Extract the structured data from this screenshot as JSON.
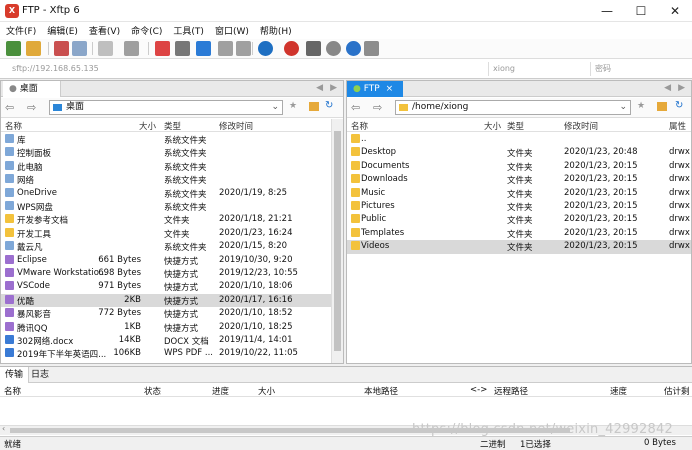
{
  "window": {
    "title": "FTP - Xftp 6",
    "minimize": "—",
    "maximize": "☐",
    "close": "✕"
  },
  "menu": [
    "文件(F)",
    "编辑(E)",
    "查看(V)",
    "命令(C)",
    "工具(T)",
    "窗口(W)",
    "帮助(H)"
  ],
  "address": {
    "host": "sftp://192.168.65.135",
    "user": "xiong",
    "password": "密码"
  },
  "left_panel": {
    "tab": "桌面",
    "path": "桌面",
    "columns": [
      "名称",
      "大小",
      "类型",
      "修改时间"
    ],
    "rows": [
      {
        "name": "库",
        "size": "",
        "type": "系统文件夹",
        "time": ""
      },
      {
        "name": "控制面板",
        "size": "",
        "type": "系统文件夹",
        "time": ""
      },
      {
        "name": "此电脑",
        "size": "",
        "type": "系统文件夹",
        "time": ""
      },
      {
        "name": "网络",
        "size": "",
        "type": "系统文件夹",
        "time": ""
      },
      {
        "name": "OneDrive",
        "size": "",
        "type": "系统文件夹",
        "time": "2020/1/19, 8:25"
      },
      {
        "name": "WPS网盘",
        "size": "",
        "type": "系统文件夹",
        "time": ""
      },
      {
        "name": "开发参考文档",
        "size": "",
        "type": "文件夹",
        "time": "2020/1/18, 21:21"
      },
      {
        "name": "开发工具",
        "size": "",
        "type": "文件夹",
        "time": "2020/1/23, 16:24"
      },
      {
        "name": "戴云凡",
        "size": "",
        "type": "系统文件夹",
        "time": "2020/1/15, 8:20"
      },
      {
        "name": "Eclipse",
        "size": "661 Bytes",
        "type": "快捷方式",
        "time": "2019/10/30, 9:20"
      },
      {
        "name": "VMware Workstatio...",
        "size": "698 Bytes",
        "type": "快捷方式",
        "time": "2019/12/23, 10:55"
      },
      {
        "name": "VSCode",
        "size": "971 Bytes",
        "type": "快捷方式",
        "time": "2020/1/10, 18:06"
      },
      {
        "name": "优酷",
        "size": "2KB",
        "type": "快捷方式",
        "time": "2020/1/17, 16:16"
      },
      {
        "name": "暴风影音",
        "size": "772 Bytes",
        "type": "快捷方式",
        "time": "2020/1/10, 18:52"
      },
      {
        "name": "腾讯QQ",
        "size": "1KB",
        "type": "快捷方式",
        "time": "2020/1/10, 18:25"
      },
      {
        "name": "302网络.docx",
        "size": "14KB",
        "type": "DOCX 文档",
        "time": "2019/11/4, 14:01"
      },
      {
        "name": "2019年下半年英语四...",
        "size": "106KB",
        "type": "WPS PDF ...",
        "time": "2019/10/22, 11:05"
      }
    ]
  },
  "right_panel": {
    "tab": "FTP",
    "path": "/home/xiong",
    "columns": [
      "名称",
      "大小",
      "类型",
      "修改时间",
      "属性"
    ],
    "rows": [
      {
        "name": "..",
        "size": "",
        "type": "",
        "time": "",
        "attr": ""
      },
      {
        "name": "Desktop",
        "size": "",
        "type": "文件夹",
        "time": "2020/1/23, 20:48",
        "attr": "drwx"
      },
      {
        "name": "Documents",
        "size": "",
        "type": "文件夹",
        "time": "2020/1/23, 20:15",
        "attr": "drwx"
      },
      {
        "name": "Downloads",
        "size": "",
        "type": "文件夹",
        "time": "2020/1/23, 20:15",
        "attr": "drwx"
      },
      {
        "name": "Music",
        "size": "",
        "type": "文件夹",
        "time": "2020/1/23, 20:15",
        "attr": "drwx"
      },
      {
        "name": "Pictures",
        "size": "",
        "type": "文件夹",
        "time": "2020/1/23, 20:15",
        "attr": "drwx"
      },
      {
        "name": "Public",
        "size": "",
        "type": "文件夹",
        "time": "2020/1/23, 20:15",
        "attr": "drwx"
      },
      {
        "name": "Templates",
        "size": "",
        "type": "文件夹",
        "time": "2020/1/23, 20:15",
        "attr": "drwx"
      },
      {
        "name": "Videos",
        "size": "",
        "type": "文件夹",
        "time": "2020/1/23, 20:15",
        "attr": "drwx"
      }
    ]
  },
  "transfer": {
    "tabs": [
      "传输",
      "日志"
    ],
    "columns": [
      "名称",
      "状态",
      "进度",
      "大小",
      "本地路径",
      "<->",
      "远程路径",
      "速度",
      "估计剩"
    ]
  },
  "status": {
    "ready": "就绪",
    "mode": "二进制",
    "selected": "1已选择",
    "bytes": "0 Bytes"
  },
  "watermark": "https://blog.csdn.net/weixin_42992842"
}
